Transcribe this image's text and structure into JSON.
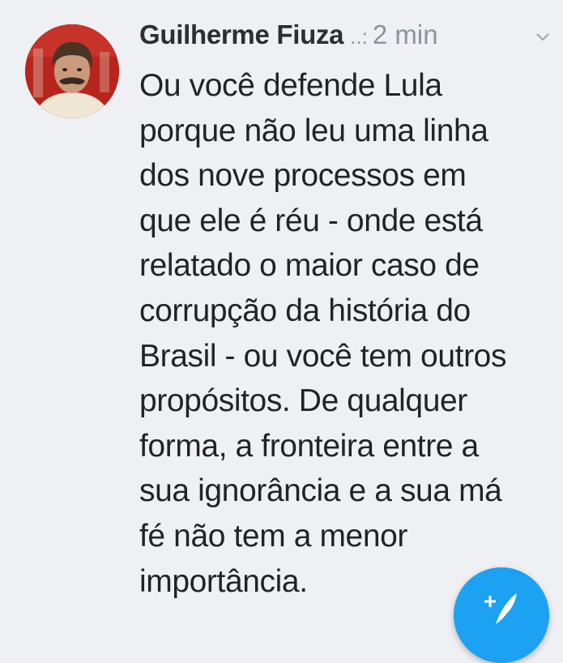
{
  "tweet": {
    "author_name": "Guilherme Fiuza",
    "handle_truncated": "..:",
    "time": "2 min",
    "text_lines": [
      "Ou você defende Lula",
      "porque não leu uma linha",
      "dos nove processos em",
      "que ele é réu - onde está",
      "relatado o maior caso de",
      "corrupção da história do",
      "Brasil - ou você tem outros",
      "propósitos. De qualquer",
      "forma, a fronteira entre a",
      "sua ignorância e a sua má",
      "fé não tem a menor",
      "importância."
    ]
  },
  "icons": {
    "avatar": "avatar-photo",
    "menu": "chevron-down-icon",
    "compose": "compose-tweet-icon"
  },
  "colors": {
    "background": "#eef0f3",
    "text": "#1f2428",
    "muted": "#8a949c",
    "accent": "#1da1f2"
  }
}
